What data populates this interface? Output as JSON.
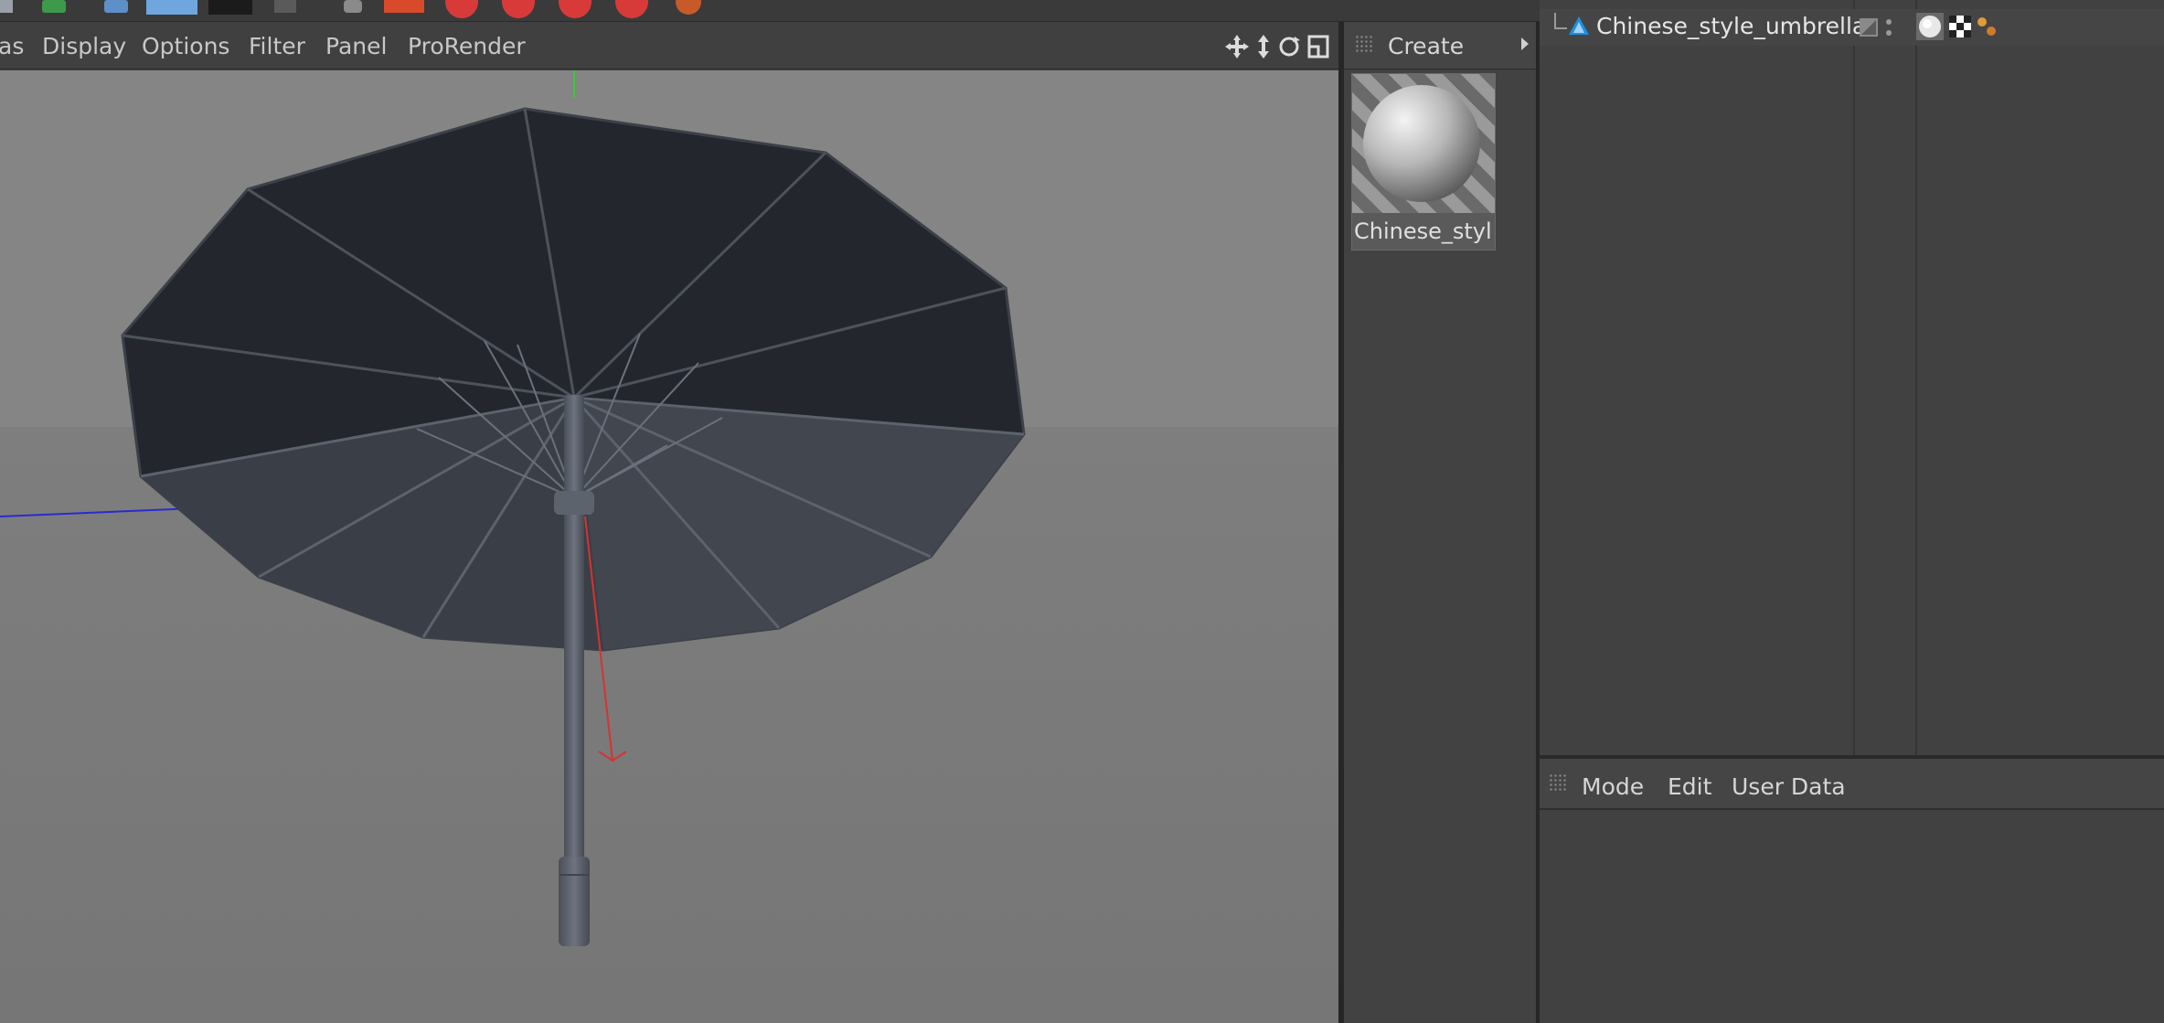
{
  "viewport": {
    "menu": [
      {
        "id": "cameras",
        "label": "as"
      },
      {
        "id": "display",
        "label": "Display"
      },
      {
        "id": "options",
        "label": "Options"
      },
      {
        "id": "filter",
        "label": "Filter"
      },
      {
        "id": "panel",
        "label": "Panel"
      },
      {
        "id": "prorender",
        "label": "ProRender"
      }
    ],
    "nav_icons": [
      "move-view-icon",
      "dolly-view-icon",
      "rotate-view-icon",
      "toggle-layout-icon"
    ],
    "background_color": "#7a7a7a",
    "horizon_upper_color": "#858585",
    "model_color": "#3b3e44"
  },
  "material_manager": {
    "menu_label": "Create",
    "materials": [
      {
        "name": "Chinese_style"
      }
    ]
  },
  "object_manager": {
    "objects": [
      {
        "name": "Chinese_style_umbrella",
        "icon": "polygon-object-icon",
        "tags": [
          "material-tag-icon",
          "texture-tag-icon",
          "phong-tag-icon"
        ]
      }
    ]
  },
  "attribute_manager": {
    "menu": [
      {
        "id": "mode",
        "label": "Mode"
      },
      {
        "id": "edit",
        "label": "Edit"
      },
      {
        "id": "user_data",
        "label": "User Data"
      }
    ]
  }
}
